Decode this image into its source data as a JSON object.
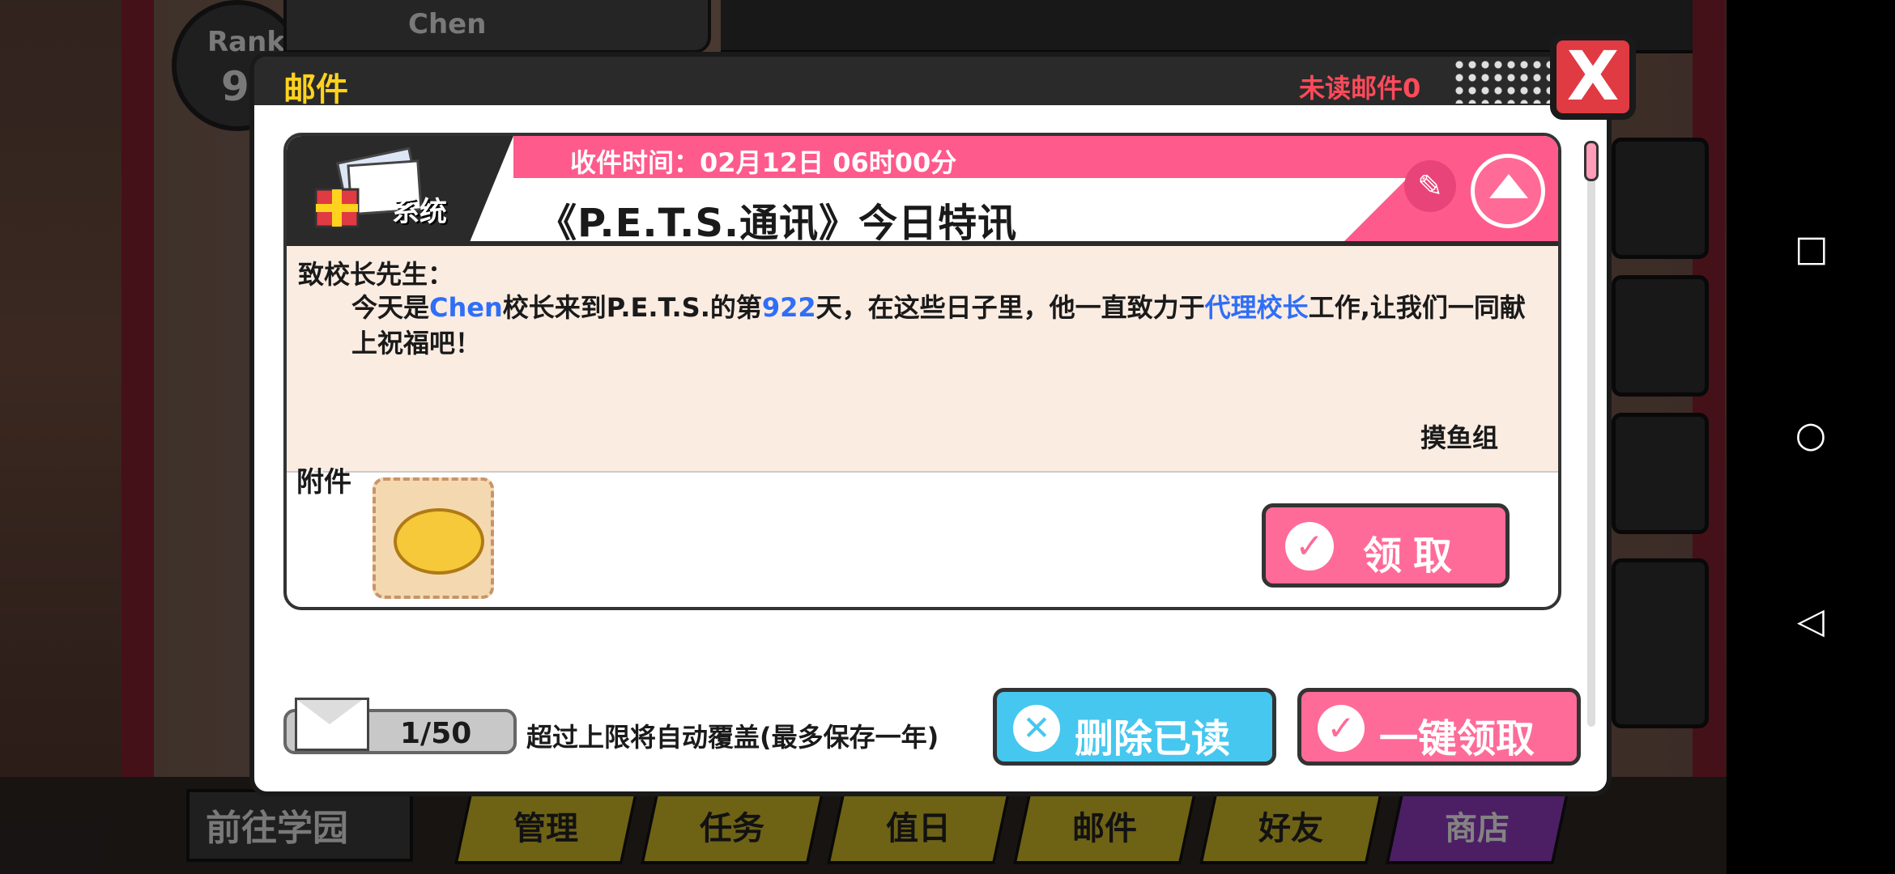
{
  "hud": {
    "rank_label": "Rank",
    "rank_value": "9",
    "player_name": "Chen"
  },
  "bottom_tabs": {
    "go_school": "前往学园",
    "items": [
      "管理",
      "任务",
      "值日",
      "邮件",
      "好友",
      "商店"
    ]
  },
  "mail": {
    "title": "邮件",
    "unread": "未读邮件0",
    "close_label": "X",
    "card": {
      "sender": "系统",
      "received_time": "收件时间：02月12日  06时00分",
      "subject": "《P.E.T.S.通讯》今日特讯",
      "greeting": "致校长先生：",
      "msg_pre": "今天是",
      "msg_name": "Chen",
      "msg_mid1": "校长来到P.E.T.S.的第",
      "msg_days": "922",
      "msg_mid2": "天，在这些日子里，他一直致力于",
      "msg_role": "代理校长",
      "msg_end": "工作,让我们一同献上祝福吧！",
      "signature": "摸鱼组",
      "attachment_label": "附件",
      "claim_label": "领取"
    },
    "footer": {
      "count": "1/50",
      "note": "超过上限将自动覆盖(最多保存一年)",
      "delete_read": "删除已读",
      "claim_all": "一键领取"
    }
  },
  "colors": {
    "accent_pink": "#ff6b98",
    "accent_blue": "#45c7ef",
    "highlight_text": "#2f6ef7"
  }
}
